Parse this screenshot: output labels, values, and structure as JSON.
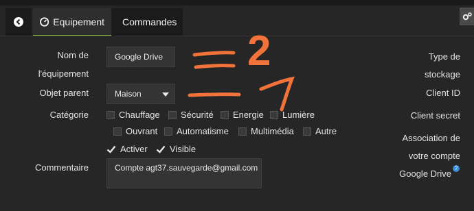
{
  "tabs": {
    "equipement": "Equipement",
    "commandes": "Commandes"
  },
  "form": {
    "nom_label_1": "Nom de",
    "nom_label_2": "l'équipement",
    "nom_value": "Google Drive",
    "objet_label": "Objet parent",
    "objet_value": "Maison",
    "categorie_label": "Catégorie",
    "categories": [
      "Chauffage",
      "Sécurité",
      "Energie",
      "Lumière",
      "Ouvrant",
      "Automatisme",
      "Multimédia",
      "Autre"
    ],
    "activer": "Activer",
    "visible": "Visible",
    "commentaire_label": "Commentaire",
    "commentaire_value": "Compte agt37.sauvegarde@gmail.com"
  },
  "right": {
    "type_1": "Type de",
    "type_2": "stockage",
    "client_id": "Client ID",
    "client_secret": "Client secret",
    "assoc_1": "Association de",
    "assoc_2": "votre compte",
    "assoc_3": "Google Drive",
    "help_glyph": "?"
  },
  "annotations": {
    "number_top": "2",
    "number_bottom": "1",
    "color": "#f2733a"
  },
  "colors": {
    "accent_tab_border": "#95b84a",
    "background": "#262626",
    "help_icon": "#3c8dde"
  }
}
